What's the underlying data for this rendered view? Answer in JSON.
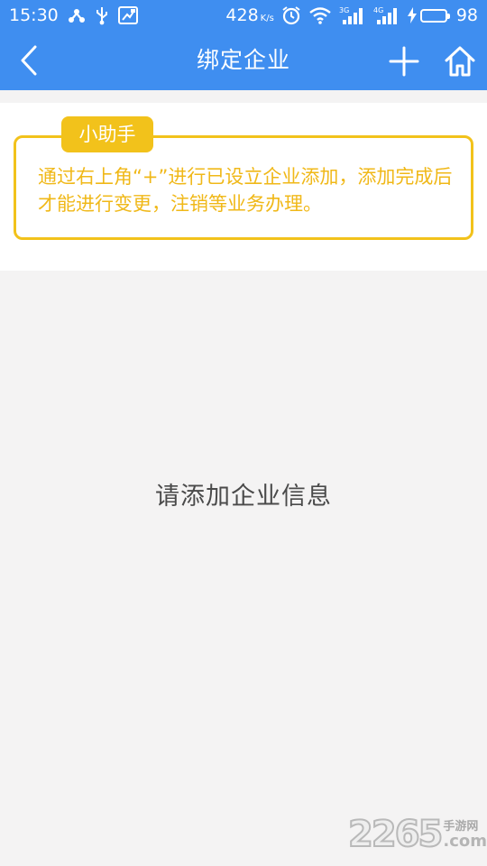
{
  "status_bar": {
    "time": "15:30",
    "net_speed": "428",
    "net_speed_unit": "K/s",
    "signal_1_label": "3G",
    "signal_2_label": "4G",
    "battery_level": "98",
    "battery_fraction": 0.98,
    "icons": [
      "usb-tether-icon",
      "usb-icon",
      "screenshot-icon",
      "alarm-icon",
      "wifi-icon",
      "signal-icon",
      "charging-icon",
      "battery-icon"
    ]
  },
  "app_bar": {
    "title": "绑定企业",
    "back_icon": "chevron-left-icon",
    "add_icon": "plus-icon",
    "home_icon": "home-icon"
  },
  "helper": {
    "tag_label": "小助手",
    "message": "通过右上角“+”进行已设立企业添加，添加完成后才能进行变更，注销等业务办理。"
  },
  "empty_state": {
    "message": "请添加企业信息"
  },
  "watermark": {
    "number": "2265",
    "cn_label": "手游网",
    "domain": ".com"
  },
  "colors": {
    "primary_blue": "#3f8ef0",
    "helper_yellow": "#f2c21b",
    "helper_text": "#f0b818",
    "background": "#f4f3f3"
  }
}
